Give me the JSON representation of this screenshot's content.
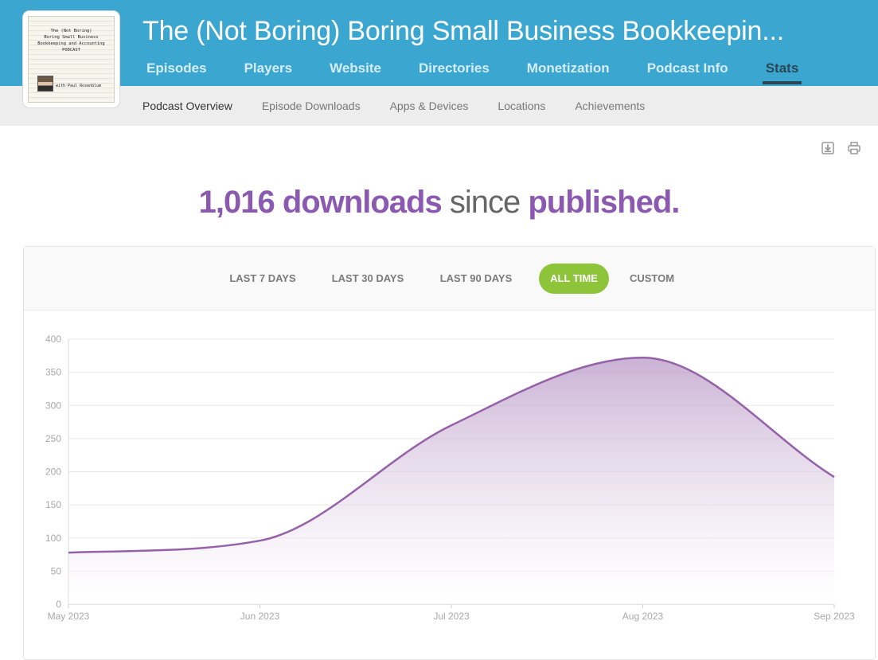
{
  "podcast": {
    "title": "The (Not Boring) Boring Small Business Bookkeepin...",
    "cover_lines": [
      "The (Not Boring)",
      "Boring Small Business",
      "Bookkeeping and Accounting",
      "PODCAST"
    ],
    "cover_byline": "with Paul Rosenblum"
  },
  "main_nav": [
    {
      "label": "Episodes"
    },
    {
      "label": "Players"
    },
    {
      "label": "Website"
    },
    {
      "label": "Directories"
    },
    {
      "label": "Monetization"
    },
    {
      "label": "Podcast Info"
    },
    {
      "label": "Stats",
      "active": true
    }
  ],
  "sub_nav": [
    {
      "label": "Podcast Overview",
      "active": true
    },
    {
      "label": "Episode Downloads"
    },
    {
      "label": "Apps & Devices"
    },
    {
      "label": "Locations"
    },
    {
      "label": "Achievements"
    }
  ],
  "toolbar": {
    "download_icon": "download-icon",
    "print_icon": "print-icon"
  },
  "headline": {
    "count": "1,016 downloads",
    "middle": "since",
    "end": "published."
  },
  "ranges": [
    {
      "label": "LAST 7 DAYS"
    },
    {
      "label": "LAST 30 DAYS"
    },
    {
      "label": "LAST 90 DAYS"
    },
    {
      "label": "ALL TIME",
      "active": true
    },
    {
      "label": "CUSTOM"
    }
  ],
  "colors": {
    "header": "#3ba6d0",
    "accent_purple": "#8b5ab0",
    "active_range": "#8dc43a",
    "series_line": "#9561a8"
  },
  "chart_data": {
    "type": "area",
    "x": [
      "May 2023",
      "Jun 2023",
      "Jul 2023",
      "Aug 2023",
      "Sep 2023"
    ],
    "values": [
      78,
      96,
      270,
      372,
      192
    ],
    "ylim": [
      0,
      400
    ],
    "yticks": [
      0,
      50,
      100,
      150,
      200,
      250,
      300,
      350,
      400
    ],
    "grid": true,
    "legend": "none"
  }
}
